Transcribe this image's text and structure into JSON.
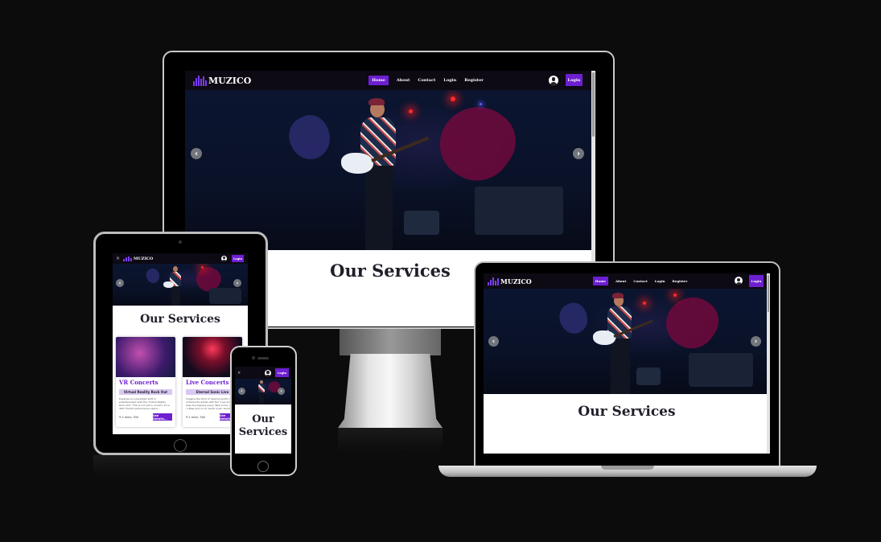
{
  "site": {
    "brand": "MUZICO",
    "nav": [
      {
        "label": "Home",
        "active": true
      },
      {
        "label": "About",
        "active": false
      },
      {
        "label": "Contact",
        "active": false
      },
      {
        "label": "Login",
        "active": false
      },
      {
        "label": "Register",
        "active": false
      }
    ],
    "login_button": "Login",
    "prev_arrow": "‹",
    "next_arrow": "›",
    "services_heading": "Our Services",
    "services_heading_phone_line1": "Our",
    "services_heading_phone_line2": "Services",
    "cards": [
      {
        "title": "VR Concerts",
        "tag": "Virtual Reality Rock Out",
        "description": "Experience a paradigm shift in entertainment with the \"Virtual Reality Rock Out\". This is not just a concert: it's a 360° Hyrbid performance space...",
        "price": "₹ 2 mins: 300",
        "button": "See Details..."
      },
      {
        "title": "Live Concerts",
        "tag": "Eternal Sonic Live",
        "description": "Imagine the thrill of hearing soulful music of favourite artists with the \"Live and Vivid\" bass toe-tapping every. Take a tour of Live 'n Bass and on to inside music world. Enjoy...",
        "price": "₹ 2 mins: 300",
        "button": "See Details..."
      }
    ]
  },
  "colors": {
    "accent": "#6d1fd1",
    "nav_background": "#0d0a14",
    "page_background": "#0c0c0d"
  },
  "icons": [
    "logo-bars-icon",
    "user-avatar-icon",
    "chevron-left-icon",
    "chevron-right-icon",
    "close-icon"
  ]
}
